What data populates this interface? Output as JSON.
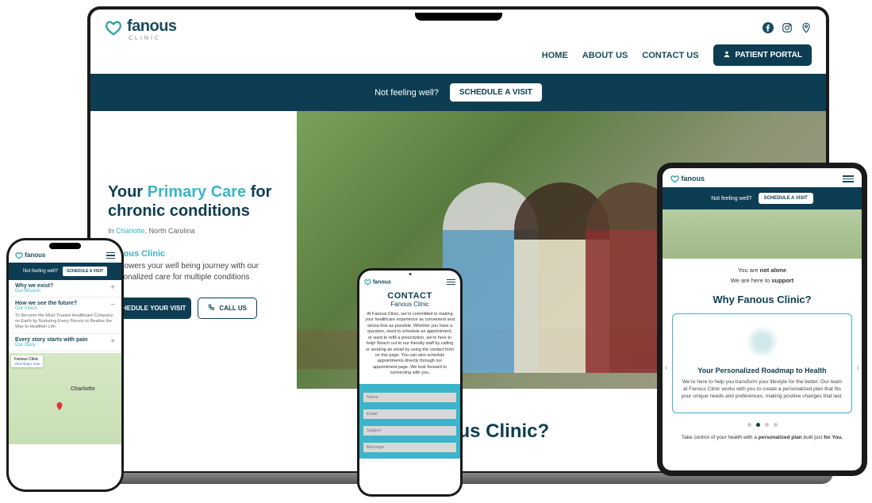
{
  "brand": {
    "name": "fanous",
    "subtitle": "CLINIC"
  },
  "laptop": {
    "nav": {
      "home": "HOME",
      "about": "ABOUT US",
      "contact": "CONTACT US",
      "portal": "PATIENT PORTAL"
    },
    "banner": {
      "text": "Not feeling well?",
      "cta": "SCHEDULE A VISIT"
    },
    "hero": {
      "title_pre": "Your ",
      "title_accent": "Primary Care",
      "title_post": " for chronic conditions",
      "loc_pre": "In ",
      "loc_city": "Charlotte",
      "loc_post": ", North Carolina",
      "clinic": "Fanous Clinic",
      "desc": "Empowers your well being journey with our personalized care for multiple conditions",
      "btn_schedule": "SCHEDULE YOUR VISIT",
      "btn_call": "CALL US"
    },
    "section_title": "Why Fanous Clinic?"
  },
  "phone1": {
    "banner": {
      "text": "Not feeling well?",
      "cta": "SCHEDULE A VISIT"
    },
    "sec1": {
      "title": "Why we exist?",
      "sub": "Our Mission"
    },
    "sec2": {
      "title": "How we see the future?",
      "sub": "Our Vision",
      "body": "To Become the Most Trusted Healthcare Company on Earth by Nurturing Every Person to Realize the Way to Healthier Life."
    },
    "sec3": {
      "title": "Every story starts with pain",
      "sub": "Our Story"
    },
    "map": {
      "title": "Fanous Clinic",
      "link": "View larger map",
      "city": "Charlotte",
      "pin": "Fanous Clinic"
    }
  },
  "phone2": {
    "title": "CONTACT",
    "subtitle": "Fanous Clinic",
    "body": "At Fanous Clinic, we're committed to making your healthcare experience as convenient and stress-free as possible. Whether you have a question, need to schedule an appointment, or want to refill a prescription, we're here to help! Reach out to our friendly staff by calling or sending an email by using the contact form on this page. You can also schedule appointments directly through our appointment page. We look forward to connecting with you.",
    "form": {
      "name": "Name",
      "email": "Email",
      "subject": "Subject",
      "message": "Message"
    }
  },
  "tablet": {
    "banner": {
      "text": "Not feeling well?",
      "cta": "SCHEDULE A VISIT"
    },
    "tag1_pre": "You are ",
    "tag1_b": "not alone",
    "tag2_pre": "We are here to ",
    "tag2_b": "support",
    "section_title": "Why Fanous Clinic?",
    "card": {
      "title": "Your Personalized Roadmap to Health",
      "body": "We're here to help you transform your lifestyle for the better. Our team at Fanous Clinic works with you to create a personalized plan that fits your unique needs and preferences, making positive changes that last."
    },
    "footer_pre": "Take control of your health with a ",
    "footer_b": "personalized plan",
    "footer_mid": " built just ",
    "footer_b2": "for You."
  }
}
